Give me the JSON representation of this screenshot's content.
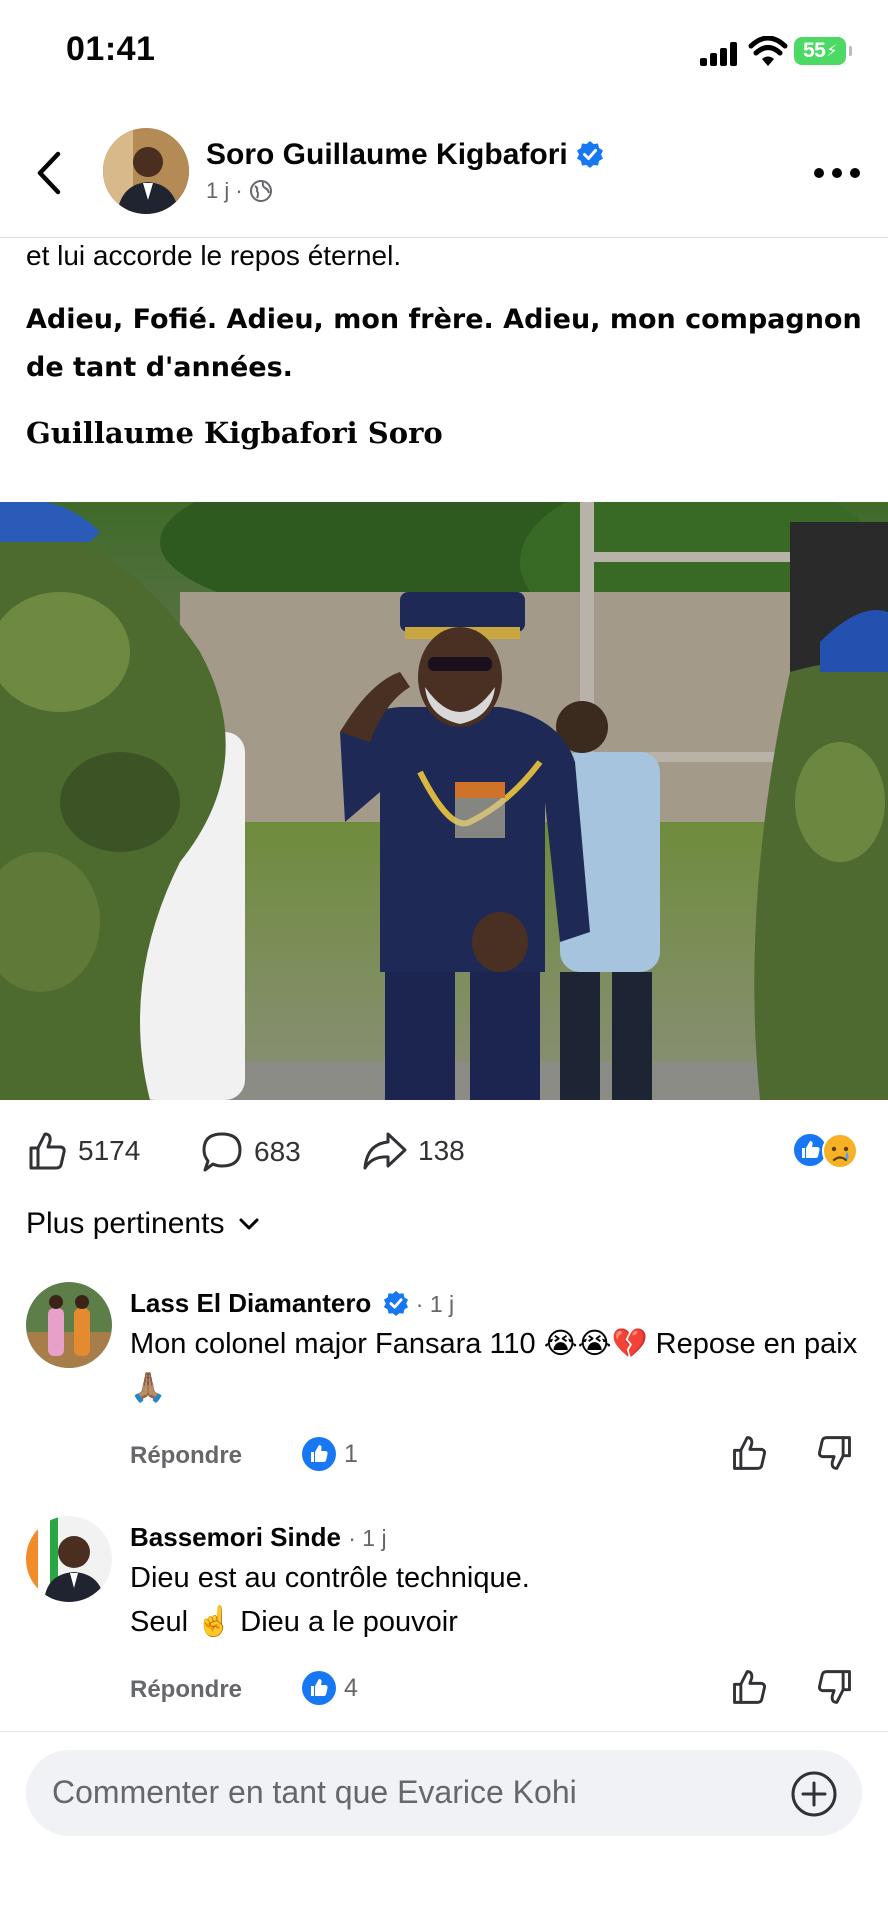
{
  "status": {
    "time": "01:41",
    "battery": "55"
  },
  "header": {
    "author": "Soro Guillaume Kigbafori",
    "meta": "1 j ·",
    "privacy_icon": "globe-icon"
  },
  "post": {
    "line1": "et lui accorde le repos éternel.",
    "bold_text": "Adieu, Fofié. Adieu, mon frère. Adieu, mon compagnon de tant d'années.",
    "signature": "Guillaume Kigbafori Soro"
  },
  "actions": {
    "likes": "5174",
    "comments": "683",
    "shares": "138"
  },
  "sort": {
    "label": "Plus pertinents"
  },
  "comments": [
    {
      "name": "Lass El Diamantero",
      "verified": true,
      "time": "· 1 j",
      "text": "Mon colonel major Fansara 110 😭😭💔 Repose en paix 🙏🏽",
      "reply": "Répondre",
      "likes": "1"
    },
    {
      "name": "Bassemori Sinde",
      "verified": false,
      "time": "· 1 j",
      "text_line1": "Dieu est au contrôle technique.",
      "text_line2": "Seul ☝️ Dieu a le pouvoir",
      "reply": "Répondre",
      "likes": "4"
    }
  ],
  "composer": {
    "placeholder": "Commenter en tant que Evarice Kohi"
  },
  "colors": {
    "accent": "#1877f2",
    "secondary_text": "#65676b",
    "composer_bg": "#f0f2f5"
  }
}
